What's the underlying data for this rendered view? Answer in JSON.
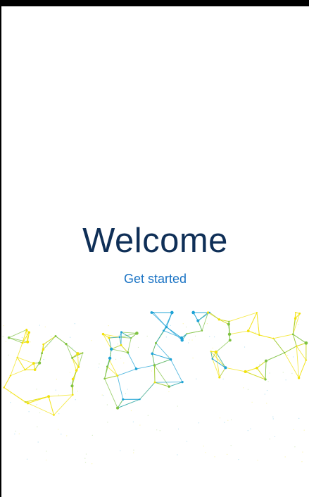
{
  "welcome": {
    "title": "Welcome",
    "cta_label": "Get started"
  },
  "colors": {
    "title": "#0f2f57",
    "cta": "#1a73c4",
    "network_yellow": "#f2e20b",
    "network_green": "#7fc241",
    "network_blue": "#1fa3d6"
  },
  "decoration": {
    "name": "network-graph-illustration"
  }
}
